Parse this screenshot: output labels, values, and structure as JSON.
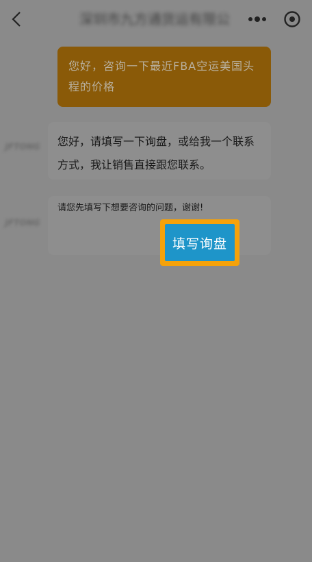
{
  "header": {
    "title": "深圳市九方通货运有限公...",
    "icons": {
      "back": "chevron-left-icon",
      "more": "more-dots-icon",
      "close": "circle-close-icon"
    }
  },
  "messages": {
    "user_text": "您好，咨询一下最近FBA空运美国头程的价格",
    "bot_text": "您好，请填写一下询盘，或给我一个联系方式，我让销售直接跟您联系。",
    "card_text": "请您先填写下想要咨询的问题，谢谢!",
    "avatar_text": "JFTONG"
  },
  "actions": {
    "inquiry_label": "填写询盘"
  },
  "colors": {
    "background": "#8a8a8a",
    "user_bubble": "#8a5a08",
    "button_blue": "#1e95c9",
    "highlight_orange": "#f5a20a"
  }
}
